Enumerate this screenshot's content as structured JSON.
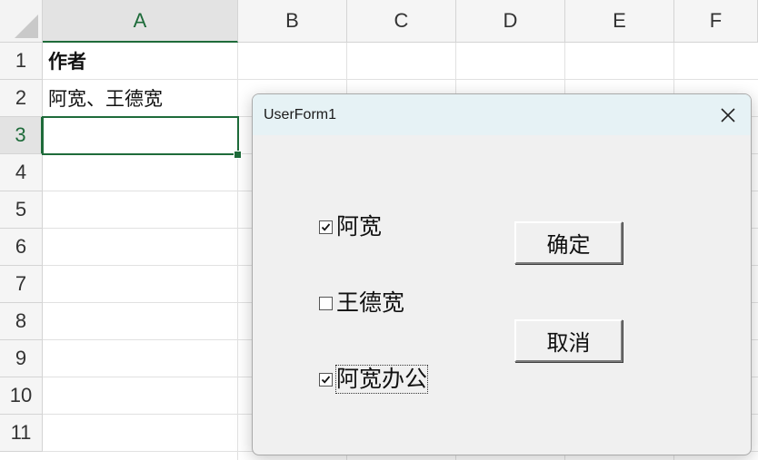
{
  "spreadsheet": {
    "columns": [
      "A",
      "B",
      "C",
      "D",
      "E",
      "F"
    ],
    "active_column": "A",
    "rows": [
      "1",
      "2",
      "3",
      "4",
      "5",
      "6",
      "7",
      "8",
      "9",
      "10",
      "11"
    ],
    "active_row": "3",
    "cells": {
      "A1": "作者",
      "A2": "阿宽、王德宽",
      "A3": ""
    },
    "selected_cell": "A3"
  },
  "dialog": {
    "title": "UserForm1",
    "checkboxes": [
      {
        "label": "阿宽",
        "checked": true
      },
      {
        "label": "王德宽",
        "checked": false
      },
      {
        "label": "阿宽办公",
        "checked": true
      }
    ],
    "buttons": {
      "ok_label": "确定",
      "cancel_label": "取消"
    }
  },
  "colors": {
    "accent_green": "#1e6b3a",
    "titlebar_bg": "#e6f2f5",
    "dialog_bg": "#f0f0f0"
  },
  "icons": {
    "close": "close-icon",
    "check": "check-icon"
  }
}
